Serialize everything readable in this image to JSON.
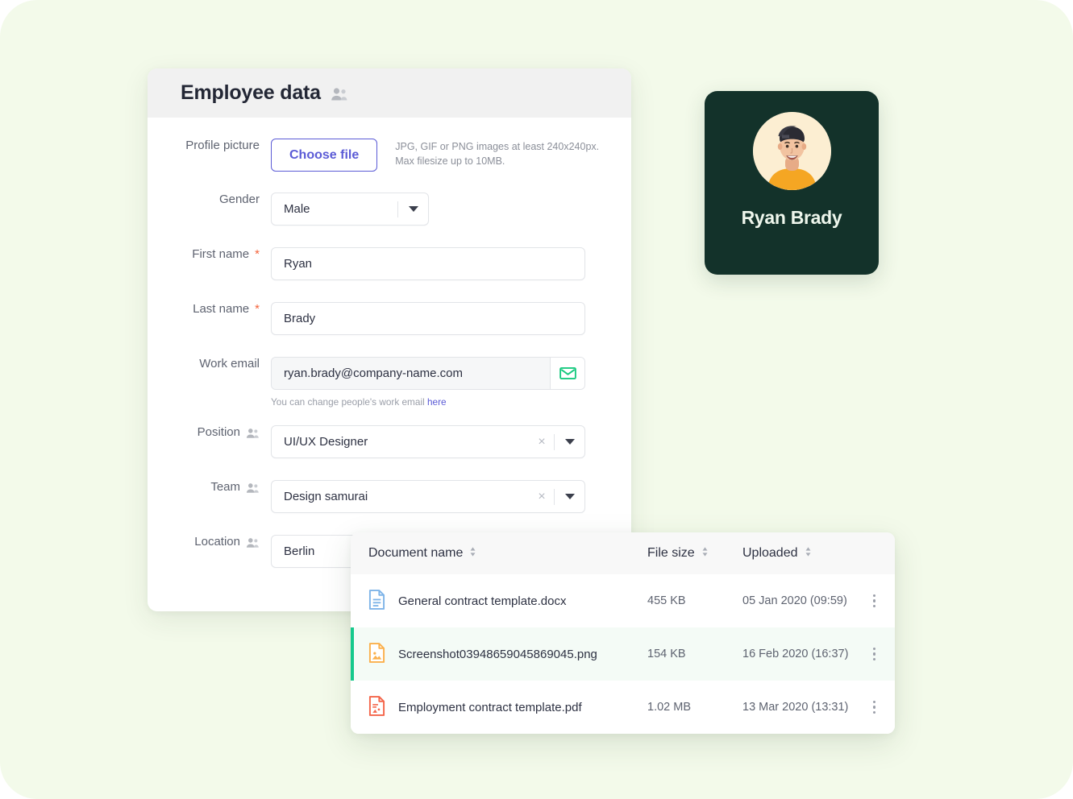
{
  "form": {
    "header_title": "Employee data",
    "header_icon": "people-icon",
    "fields": {
      "profile_picture": {
        "label": "Profile picture",
        "button_label": "Choose file",
        "hint_line1": "JPG, GIF or PNG images at least 240x240px.",
        "hint_line2": "Max filesize up to 10MB."
      },
      "gender": {
        "label": "Gender",
        "value": "Male"
      },
      "first_name": {
        "label": "First name",
        "required_mark": "*",
        "value": "Ryan"
      },
      "last_name": {
        "label": "Last name",
        "required_mark": "*",
        "value": "Brady"
      },
      "work_email": {
        "label": "Work email",
        "value": "ryan.brady@company-name.com",
        "icon": "envelope-icon",
        "sub_hint_text": "You can change people's work email ",
        "sub_hint_link": "here"
      },
      "position": {
        "label": "Position",
        "value": "UI/UX Designer",
        "clear": "×"
      },
      "team": {
        "label": "Team",
        "value": "Design samurai",
        "clear": "×"
      },
      "location": {
        "label": "Location",
        "value": "Berlin"
      }
    }
  },
  "profile_card": {
    "name": "Ryan Brady",
    "avatar_alt": "Ryan Brady profile photo",
    "bg_color": "#13322a",
    "avatar_bg": "#fceed2",
    "shirt_color": "#f5a623"
  },
  "documents": {
    "columns": [
      {
        "label": "Document name",
        "sortable": true
      },
      {
        "label": "File size",
        "sortable": true
      },
      {
        "label": "Uploaded",
        "sortable": true
      }
    ],
    "rows": [
      {
        "icon": "file-doc-icon",
        "icon_color": "#7eb4e8",
        "name": "General contract template.docx",
        "size": "455 KB",
        "uploaded": "05 Jan 2020 (09:59)",
        "selected": false
      },
      {
        "icon": "file-image-icon",
        "icon_color": "#fbb04c",
        "name": "Screenshot03948659045869045.png",
        "size": "154 KB",
        "uploaded": "16 Feb 2020 (16:37)",
        "selected": true
      },
      {
        "icon": "file-pdf-icon",
        "icon_color": "#f4654a",
        "name": "Employment contract template.pdf",
        "size": "1.02 MB",
        "uploaded": "13 Mar 2020 (13:31)",
        "selected": false
      }
    ]
  },
  "theme": {
    "page_bg": "#f3faea",
    "accent_purple": "#5b5bd6",
    "accent_green": "#16c98d",
    "required_red": "#f4623a"
  }
}
